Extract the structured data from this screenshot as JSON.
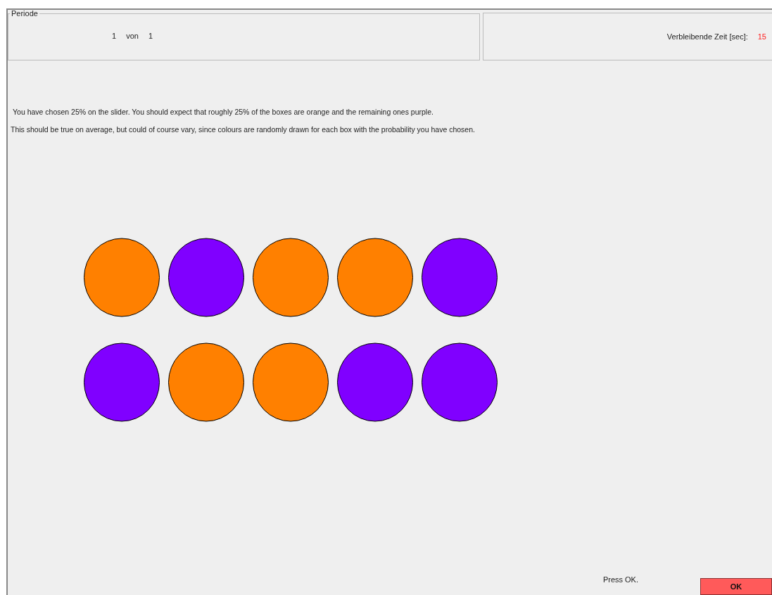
{
  "period": {
    "legend": "Periode",
    "current": "1",
    "of": "von",
    "total": "1"
  },
  "timer": {
    "label": "Verbleibende Zeit [sec]:",
    "value": "15"
  },
  "messages": [
    "You have chosen 25% on the slider. You should expect that roughly 25% of the boxes are orange and the remaining ones purple.",
    "This should be true on average, but could of course vary, since colours are randomly drawn for each box with the probability you have chosen."
  ],
  "boxes": [
    [
      {
        "color": "#ff8000"
      },
      {
        "color": "#8000ff"
      },
      {
        "color": "#ff8000"
      },
      {
        "color": "#ff8000"
      },
      {
        "color": "#8000ff"
      }
    ],
    [
      {
        "color": "#8000ff"
      },
      {
        "color": "#ff8000"
      },
      {
        "color": "#ff8000"
      },
      {
        "color": "#8000ff"
      },
      {
        "color": "#8000ff"
      }
    ]
  ],
  "footer": {
    "hint": "Press OK.",
    "button": "OK"
  }
}
